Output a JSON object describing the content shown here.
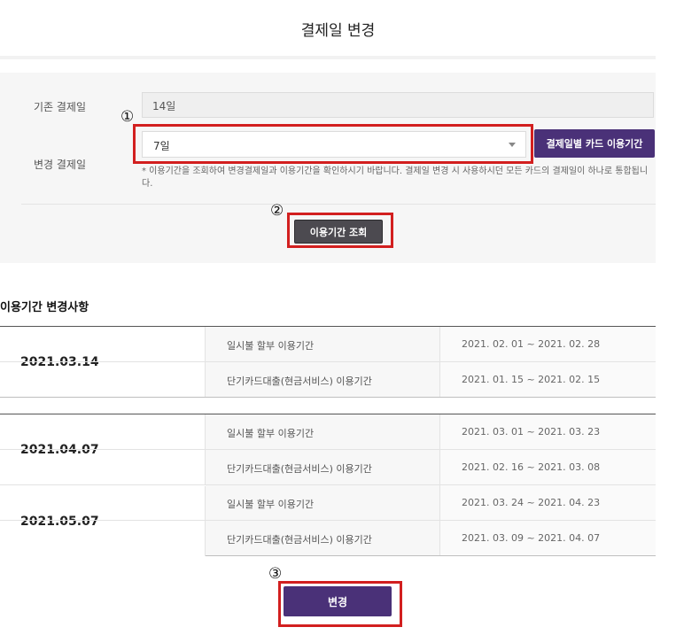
{
  "page": {
    "title": "결제일 변경"
  },
  "form": {
    "current_label": "기존 결제일",
    "current_value": "14일",
    "new_label": "변경 결제일",
    "new_value": "7일",
    "card_period_button": "결제일별 카드 이용기간",
    "notice": "* 이용기간을 조회하여 변경결제일과 이용기간을 확인하시기 바랍니다. 결제일 변경 시 사용하시던 모든 카드의 결제일이 하나로 통합됩니다.",
    "query_button": "이용기간 조회"
  },
  "markers": [
    "①",
    "②",
    "③"
  ],
  "changes": {
    "title": "이용기간 변경사항",
    "tables": [
      {
        "groups": [
          {
            "date": "2021.03.14",
            "rows": [
              {
                "type": "일시불 할부 이용기간",
                "period": "2021. 02. 01 ~ 2021. 02. 28"
              },
              {
                "type": "단기카드대출(현금서비스) 이용기간",
                "period": "2021. 01. 15 ~ 2021. 02. 15"
              }
            ]
          }
        ]
      },
      {
        "groups": [
          {
            "date": "2021.04.07",
            "rows": [
              {
                "type": "일시불 할부 이용기간",
                "period": "2021. 03. 01 ~ 2021. 03. 23"
              },
              {
                "type": "단기카드대출(현금서비스) 이용기간",
                "period": "2021. 02. 16 ~ 2021. 03. 08"
              }
            ]
          },
          {
            "date": "2021.05.07",
            "rows": [
              {
                "type": "일시불 할부 이용기간",
                "period": "2021. 03. 24 ~ 2021. 04. 23"
              },
              {
                "type": "단기카드대출(현금서비스) 이용기간",
                "period": "2021. 03. 09 ~ 2021. 04. 07"
              }
            ]
          }
        ]
      }
    ]
  },
  "change_button": "변경",
  "colors": {
    "accent": "#4a3178",
    "highlight": "#d21f1f",
    "query_button": "#4c4a50"
  }
}
